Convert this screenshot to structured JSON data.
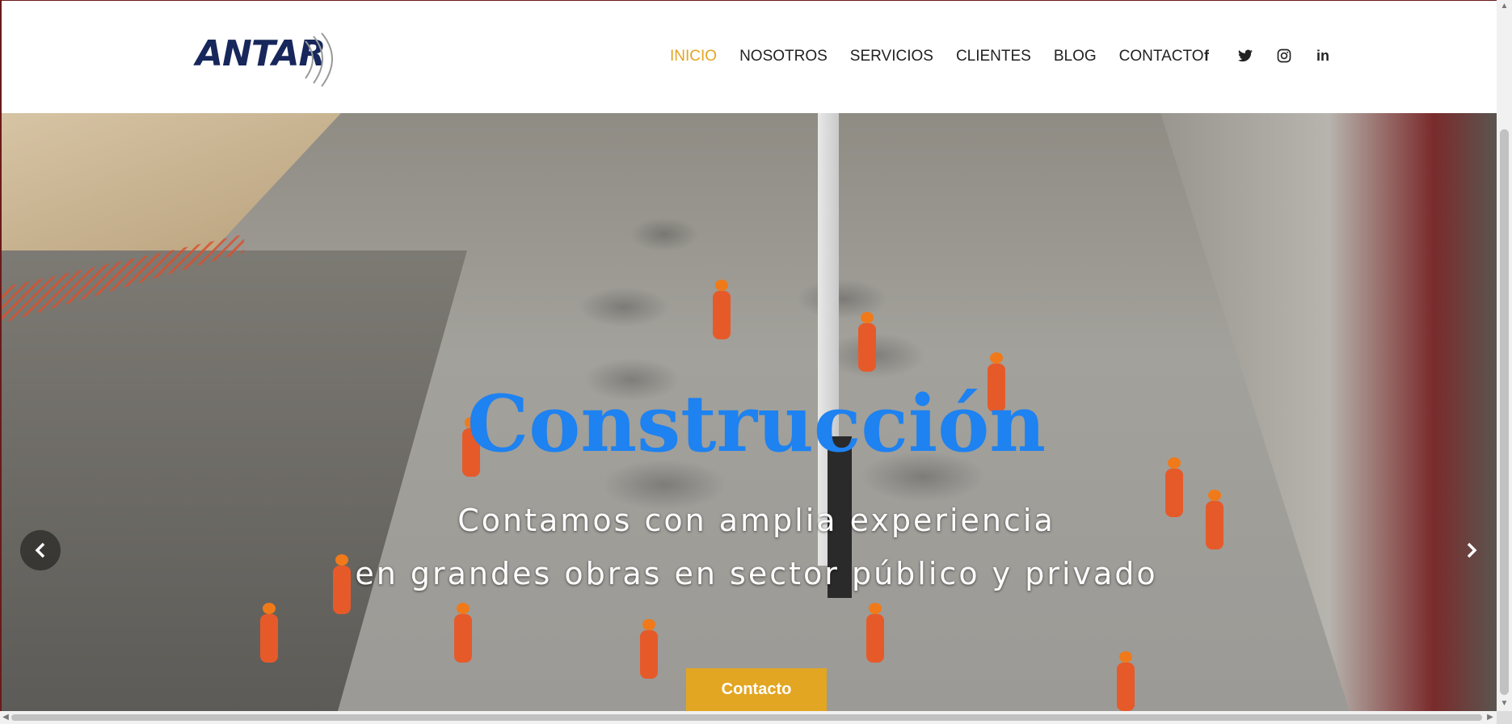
{
  "header": {
    "logo_text": "ANTAR",
    "nav": [
      {
        "label": "INICIO",
        "active": true
      },
      {
        "label": "NOSOTROS",
        "active": false
      },
      {
        "label": "SERVICIOS",
        "active": false
      },
      {
        "label": "CLIENTES",
        "active": false
      },
      {
        "label": "BLOG",
        "active": false
      },
      {
        "label": "CONTACTO",
        "active": false
      }
    ],
    "social": [
      {
        "icon": "facebook-icon",
        "glyph": "f"
      },
      {
        "icon": "twitter-icon",
        "glyph": "🐦"
      },
      {
        "icon": "instagram-icon",
        "glyph": "◎"
      },
      {
        "icon": "linkedin-icon",
        "glyph": "in"
      }
    ]
  },
  "hero": {
    "title": "Construcción",
    "subtitle_line1": "Contamos con amplia experiencia",
    "subtitle_line2": "en grandes obras en sector público y privado",
    "cta_label": "Contacto",
    "prev_glyph": "‹",
    "next_glyph": "›"
  },
  "colors": {
    "accent": "#e2a623",
    "title_blue": "#1e82f0",
    "logo_navy": "#17275b"
  }
}
